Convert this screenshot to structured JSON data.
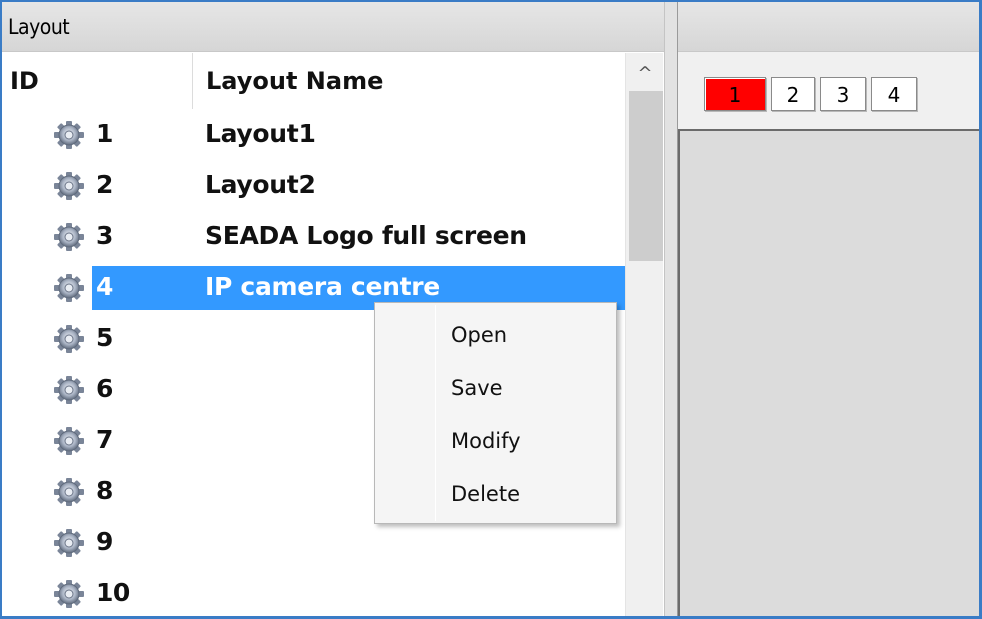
{
  "panel": {
    "title": "Layout"
  },
  "columns": {
    "id": "ID",
    "name": "Layout Name"
  },
  "rows": [
    {
      "id": "1",
      "name": "Layout1"
    },
    {
      "id": "2",
      "name": "Layout2"
    },
    {
      "id": "3",
      "name": "SEADA Logo full screen"
    },
    {
      "id": "4",
      "name": "IP camera centre",
      "selected": true
    },
    {
      "id": "5",
      "name": ""
    },
    {
      "id": "6",
      "name": ""
    },
    {
      "id": "7",
      "name": ""
    },
    {
      "id": "8",
      "name": ""
    },
    {
      "id": "9",
      "name": ""
    },
    {
      "id": "10",
      "name": ""
    }
  ],
  "scrollbar": {
    "up_glyph": "^"
  },
  "page_tabs": [
    "1",
    "2",
    "3",
    "4"
  ],
  "active_page": "1",
  "context_menu": {
    "items": [
      "Open",
      "Save",
      "Modify",
      "Delete"
    ]
  },
  "colors": {
    "selection": "#3399ff",
    "active_tab": "#ff0000",
    "frame_border": "#3a7cc6"
  },
  "icons": {
    "row_icon": "gear-icon"
  }
}
